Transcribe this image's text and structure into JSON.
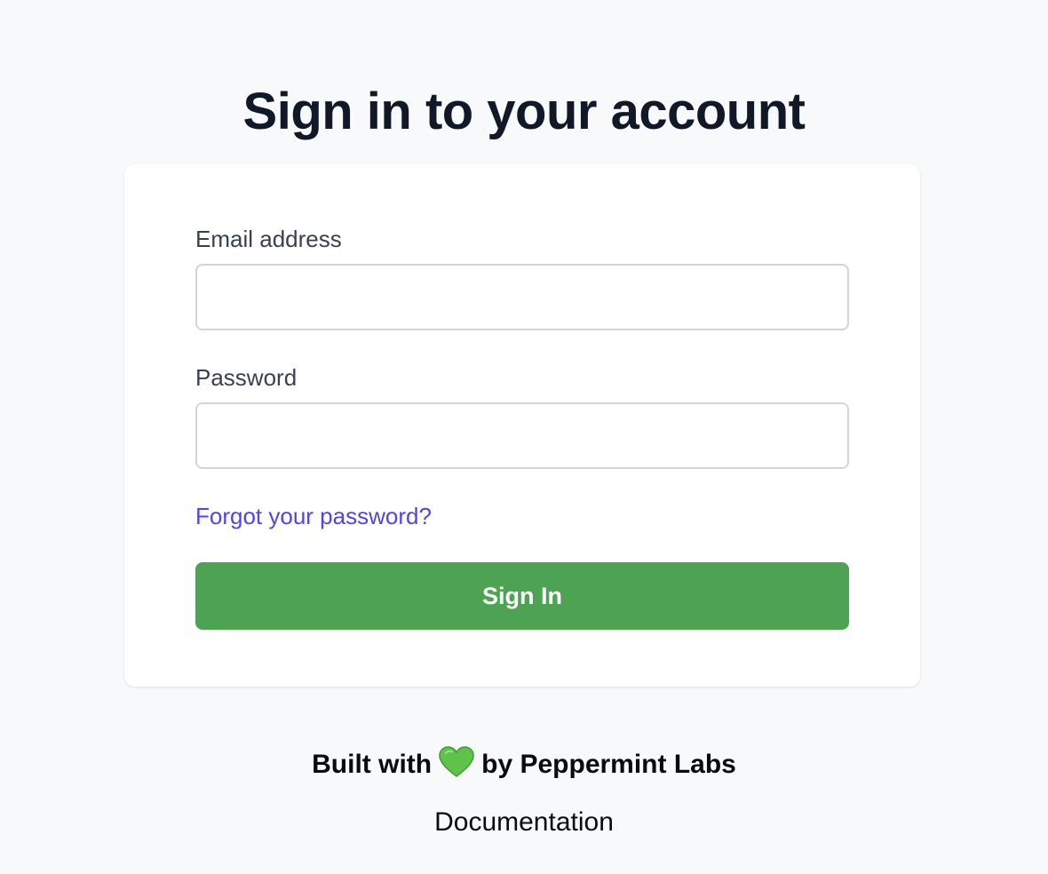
{
  "page": {
    "title": "Sign in to your account"
  },
  "form": {
    "email_label": "Email address",
    "email_value": "",
    "email_placeholder": "",
    "password_label": "Password",
    "password_value": "",
    "password_placeholder": "",
    "forgot_link": "Forgot your password?",
    "submit_label": "Sign In"
  },
  "footer": {
    "credit_prefix": "Built with",
    "credit_icon": "green-heart-icon",
    "credit_suffix": "by Peppermint Labs",
    "docs_link": "Documentation"
  },
  "colors": {
    "background": "#f8f9fb",
    "card": "#ffffff",
    "accent_link": "#4f46e5",
    "button": "#4ea254",
    "heart": "#5ec24b"
  }
}
